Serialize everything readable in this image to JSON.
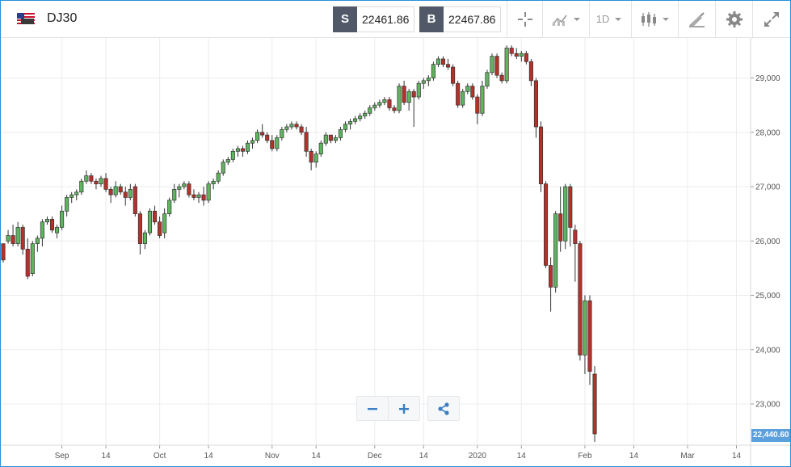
{
  "header": {
    "symbol": "DJ30",
    "flag_icon": "us-flag-icon",
    "sell_tag": "S",
    "sell_price": "22461.86",
    "buy_tag": "B",
    "buy_price": "22467.86",
    "timeframe": "1D"
  },
  "toolbar_icons": [
    "crosshair-icon",
    "chart-type-icon",
    "indicators-icon",
    "drawing-icon",
    "gear-icon",
    "fullscreen-icon"
  ],
  "last_price_label": "22,440.60",
  "colors": {
    "up": "#5fb45f",
    "down": "#b5322a",
    "accent": "#2a8fd8",
    "tag_bg": "#515969",
    "last_price_bg": "#5b9fdc"
  },
  "chart_data": {
    "type": "candlestick",
    "y_ticks": [
      "23,000",
      "24,000",
      "25,000",
      "26,000",
      "27,000",
      "28,000",
      "29,000"
    ],
    "y_tick_values": [
      23000,
      24000,
      25000,
      26000,
      27000,
      28000,
      29000
    ],
    "x_labels": [
      {
        "label": "Sep",
        "index": 12
      },
      {
        "label": "14",
        "index": 21
      },
      {
        "label": "Oct",
        "index": 32
      },
      {
        "label": "14",
        "index": 42
      },
      {
        "label": "Nov",
        "index": 55
      },
      {
        "label": "14",
        "index": 64
      },
      {
        "label": "Dec",
        "index": 76
      },
      {
        "label": "14",
        "index": 86
      },
      {
        "label": "2020",
        "index": 97
      },
      {
        "label": "14",
        "index": 106
      },
      {
        "label": "Feb",
        "index": 119
      },
      {
        "label": "14",
        "index": 129
      },
      {
        "label": "Mar",
        "index": 140
      },
      {
        "label": "14",
        "index": 150
      }
    ],
    "ylim": [
      22200,
      29700
    ],
    "candles": [
      [
        25950,
        25950,
        25600,
        25650
      ],
      [
        26000,
        26200,
        25950,
        26100
      ],
      [
        26100,
        26300,
        25900,
        25950
      ],
      [
        25950,
        26350,
        25900,
        26250
      ],
      [
        26250,
        26300,
        25750,
        25850
      ],
      [
        25850,
        26050,
        25300,
        25350
      ],
      [
        25400,
        26000,
        25350,
        25950
      ],
      [
        25950,
        26100,
        25800,
        26050
      ],
      [
        26050,
        26400,
        25900,
        26350
      ],
      [
        26350,
        26450,
        26300,
        26400
      ],
      [
        26400,
        26450,
        26150,
        26200
      ],
      [
        26150,
        26300,
        26050,
        26250
      ],
      [
        26250,
        26650,
        26200,
        26550
      ],
      [
        26550,
        26850,
        26450,
        26800
      ],
      [
        26800,
        26900,
        26700,
        26850
      ],
      [
        26850,
        26950,
        26750,
        26900
      ],
      [
        26900,
        27150,
        26850,
        27100
      ],
      [
        27100,
        27300,
        27050,
        27200
      ],
      [
        27200,
        27250,
        27050,
        27100
      ],
      [
        27100,
        27150,
        26950,
        27050
      ],
      [
        27050,
        27200,
        27000,
        27150
      ],
      [
        27150,
        27250,
        26900,
        26950
      ],
      [
        26950,
        27000,
        26700,
        26850
      ],
      [
        26850,
        27100,
        26800,
        27000
      ],
      [
        27000,
        27050,
        26850,
        26900
      ],
      [
        26900,
        27000,
        26650,
        26800
      ],
      [
        26800,
        27050,
        26750,
        26950
      ],
      [
        27000,
        27050,
        26450,
        26500
      ],
      [
        26500,
        26550,
        25750,
        25950
      ],
      [
        25950,
        26200,
        25850,
        26150
      ],
      [
        26150,
        26600,
        26100,
        26550
      ],
      [
        26550,
        26650,
        26300,
        26350
      ],
      [
        26350,
        26450,
        26050,
        26100
      ],
      [
        26150,
        26600,
        26050,
        26500
      ],
      [
        26500,
        26800,
        26450,
        26750
      ],
      [
        26750,
        27050,
        26700,
        26950
      ],
      [
        26950,
        27050,
        26800,
        27000
      ],
      [
        27000,
        27100,
        26950,
        27050
      ],
      [
        27050,
        27100,
        26800,
        26850
      ],
      [
        26850,
        26950,
        26750,
        26800
      ],
      [
        26800,
        26900,
        26700,
        26850
      ],
      [
        26850,
        27000,
        26650,
        26750
      ],
      [
        26750,
        27100,
        26700,
        27050
      ],
      [
        27050,
        27150,
        26950,
        27100
      ],
      [
        27100,
        27300,
        27050,
        27250
      ],
      [
        27250,
        27500,
        27200,
        27450
      ],
      [
        27450,
        27550,
        27400,
        27500
      ],
      [
        27500,
        27700,
        27450,
        27650
      ],
      [
        27650,
        27750,
        27550,
        27700
      ],
      [
        27700,
        27750,
        27550,
        27650
      ],
      [
        27650,
        27850,
        27600,
        27800
      ],
      [
        27800,
        27900,
        27700,
        27850
      ],
      [
        27850,
        28050,
        27800,
        28000
      ],
      [
        28000,
        28150,
        27900,
        27950
      ],
      [
        27950,
        28000,
        27800,
        27850
      ],
      [
        27850,
        27950,
        27650,
        27700
      ],
      [
        27700,
        27950,
        27650,
        27900
      ],
      [
        27900,
        28100,
        27850,
        28050
      ],
      [
        28050,
        28150,
        28000,
        28100
      ],
      [
        28100,
        28200,
        28050,
        28150
      ],
      [
        28150,
        28200,
        28050,
        28100
      ],
      [
        28100,
        28150,
        27950,
        28000
      ],
      [
        28000,
        28100,
        27550,
        27650
      ],
      [
        27650,
        27700,
        27300,
        27450
      ],
      [
        27450,
        27650,
        27350,
        27600
      ],
      [
        27600,
        27850,
        27550,
        27800
      ],
      [
        27800,
        28000,
        27750,
        27950
      ],
      [
        27950,
        27950,
        27800,
        27850
      ],
      [
        27850,
        27950,
        27800,
        27900
      ],
      [
        27900,
        28100,
        27850,
        28050
      ],
      [
        28050,
        28200,
        28000,
        28150
      ],
      [
        28150,
        28250,
        28050,
        28200
      ],
      [
        28200,
        28300,
        28150,
        28250
      ],
      [
        28250,
        28350,
        28200,
        28300
      ],
      [
        28300,
        28400,
        28250,
        28350
      ],
      [
        28350,
        28500,
        28300,
        28450
      ],
      [
        28450,
        28550,
        28400,
        28500
      ],
      [
        28500,
        28600,
        28450,
        28550
      ],
      [
        28550,
        28650,
        28500,
        28600
      ],
      [
        28600,
        28650,
        28400,
        28450
      ],
      [
        28450,
        28500,
        28350,
        28400
      ],
      [
        28400,
        28900,
        28350,
        28850
      ],
      [
        28850,
        28950,
        28500,
        28550
      ],
      [
        28550,
        28800,
        28400,
        28750
      ],
      [
        28750,
        28800,
        28100,
        28650
      ],
      [
        28650,
        28950,
        28600,
        28900
      ],
      [
        28900,
        29000,
        28800,
        28950
      ],
      [
        28950,
        29050,
        28850,
        29000
      ],
      [
        29000,
        29300,
        28950,
        29250
      ],
      [
        29250,
        29400,
        29200,
        29350
      ],
      [
        29350,
        29400,
        29200,
        29250
      ],
      [
        29250,
        29350,
        29150,
        29200
      ],
      [
        29200,
        29250,
        28850,
        28900
      ],
      [
        28900,
        28950,
        28450,
        28500
      ],
      [
        28500,
        28800,
        28450,
        28750
      ],
      [
        28750,
        28900,
        28700,
        28850
      ],
      [
        28850,
        28900,
        28600,
        28650
      ],
      [
        28650,
        28700,
        28150,
        28350
      ],
      [
        28350,
        28950,
        28300,
        28850
      ],
      [
        28850,
        29150,
        28800,
        29100
      ],
      [
        29100,
        29450,
        29050,
        29400
      ],
      [
        29400,
        29450,
        29000,
        29050
      ],
      [
        29050,
        29100,
        28900,
        28950
      ],
      [
        28950,
        29600,
        28900,
        29550
      ],
      [
        29550,
        29600,
        29400,
        29450
      ],
      [
        29450,
        29550,
        29350,
        29400
      ],
      [
        29400,
        29500,
        29300,
        29450
      ],
      [
        29450,
        29500,
        29250,
        29300
      ],
      [
        29300,
        29350,
        28850,
        28950
      ],
      [
        28950,
        29000,
        27900,
        28100
      ],
      [
        28100,
        28200,
        26900,
        27050
      ],
      [
        27050,
        27100,
        25500,
        25550
      ],
      [
        25550,
        25700,
        24700,
        25150
      ],
      [
        25150,
        26550,
        25050,
        26500
      ],
      [
        26500,
        27000,
        25800,
        26000
      ],
      [
        26000,
        27050,
        25850,
        27000
      ],
      [
        27000,
        27050,
        25900,
        26250
      ],
      [
        26200,
        26300,
        25250,
        25950
      ],
      [
        25950,
        26000,
        23800,
        23900
      ],
      [
        23900,
        25000,
        23550,
        24900
      ],
      [
        24900,
        25000,
        23350,
        23600
      ],
      [
        23550,
        23700,
        22300,
        22450
      ]
    ]
  }
}
